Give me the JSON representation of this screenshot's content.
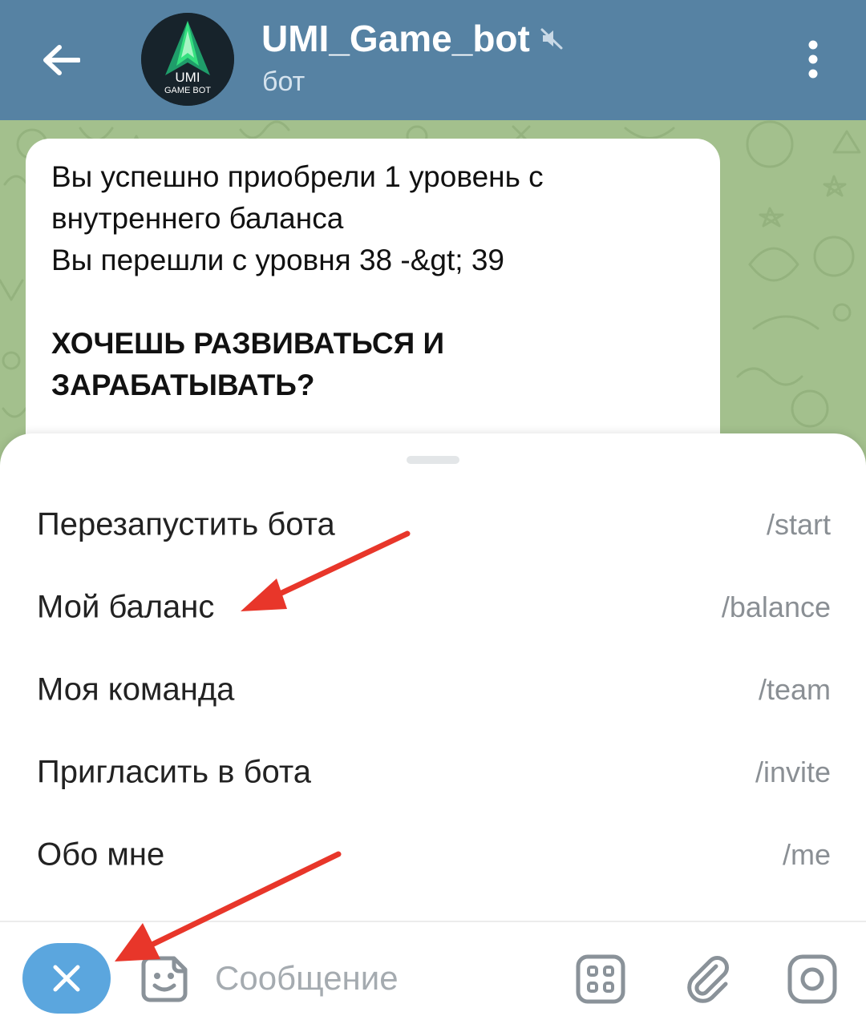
{
  "header": {
    "title": "UMI_Game_bot",
    "subtitle": "бот",
    "avatar_text_top": "UMI",
    "avatar_text_bottom": "GAME BOT",
    "back_icon": "arrow-left-icon",
    "mute_icon": "muted-speaker-icon",
    "menu_icon": "more-vertical-icon"
  },
  "message": {
    "lines": [
      "Вы успешно приобрели 1 уровень с",
      "внутреннего баланса",
      "Вы перешли с уровня 38 -&gt; 39"
    ],
    "bold_lines": [
      "ХОЧЕШЬ РАЗВИВАТЬСЯ И",
      "ЗАРАБАТЫВАТЬ?"
    ]
  },
  "commands": [
    {
      "label": "Перезапустить бота",
      "command": "/start"
    },
    {
      "label": "Мой баланс",
      "command": "/balance"
    },
    {
      "label": "Моя команда",
      "command": "/team"
    },
    {
      "label": "Пригласить в бота",
      "command": "/invite"
    },
    {
      "label": "Обо мне",
      "command": "/me"
    }
  ],
  "input": {
    "placeholder": "Сообщение",
    "close_icon": "close-icon",
    "sticker_icon": "sticker-icon",
    "commands_icon": "bot-commands-icon",
    "attach_icon": "paperclip-icon",
    "camera_icon": "camera-icon"
  },
  "colors": {
    "header_bg": "#5682a3",
    "chat_bg": "#a3c08d",
    "close_button": "#5ba6de",
    "annotation_arrow": "#e8362a",
    "avatar_accent": "#2ecc71"
  }
}
